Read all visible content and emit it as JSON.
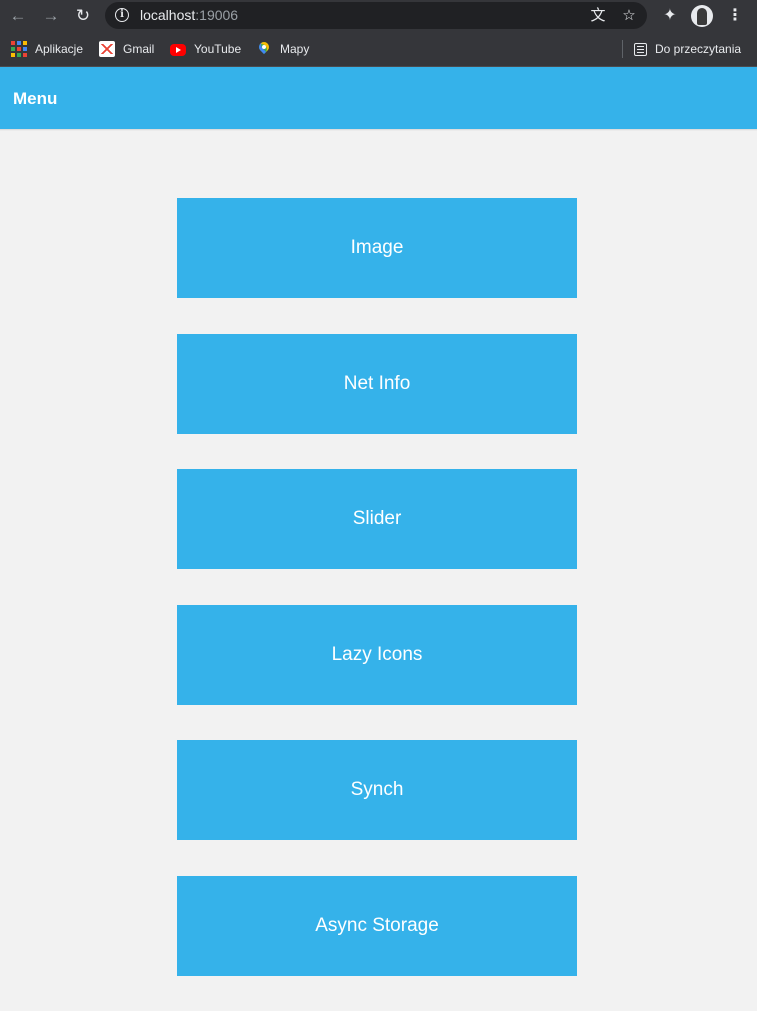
{
  "browser": {
    "url_host": "localhost",
    "url_port": ":19006",
    "bookmarks": [
      {
        "label": "Aplikacje",
        "icon": "apps-grid-icon"
      },
      {
        "label": "Gmail",
        "icon": "gmail-icon"
      },
      {
        "label": "YouTube",
        "icon": "youtube-icon"
      },
      {
        "label": "Mapy",
        "icon": "maps-icon"
      }
    ],
    "reading_list_label": "Do przeczytania"
  },
  "app": {
    "header_title": "Menu",
    "accent_color": "#35b2ea",
    "menu_items": [
      {
        "label": "Image"
      },
      {
        "label": "Net Info"
      },
      {
        "label": "Slider"
      },
      {
        "label": "Lazy Icons"
      },
      {
        "label": "Synch"
      },
      {
        "label": "Async Storage"
      }
    ]
  }
}
